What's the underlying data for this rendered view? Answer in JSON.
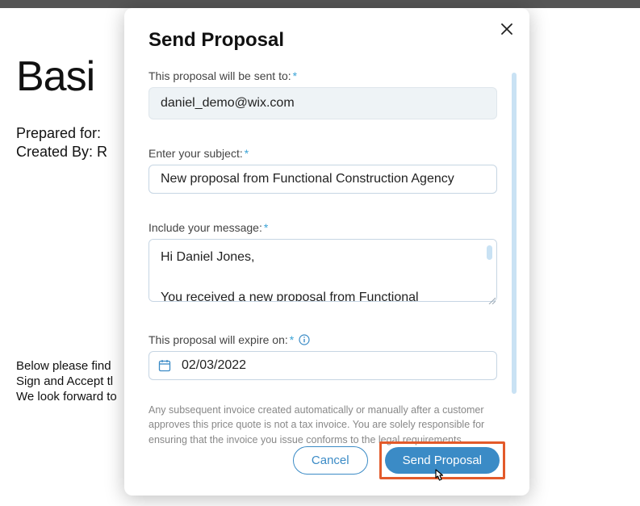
{
  "background": {
    "title": "Basi",
    "preparedFor": "Prepared for:",
    "createdBy": "Created By: R",
    "paragraph": {
      "l1": "Below please find",
      "l2": "Sign and Accept tl",
      "l3": "We look forward to"
    }
  },
  "modal": {
    "title": "Send Proposal",
    "fields": {
      "recipientLabel": "This proposal will be sent to:",
      "recipientValue": "daniel_demo@wix.com",
      "subjectLabel": "Enter your subject:",
      "subjectValue": "New proposal from Functional Construction Agency",
      "messageLabel": "Include your message:",
      "messageValue": "Hi Daniel Jones,\n\nYou received a new proposal from Functional",
      "expireLabel": "This proposal will expire on:",
      "expireValue": "02/03/2022"
    },
    "legal": "Any subsequent invoice created automatically or manually after a customer approves this price quote is not a tax invoice. You are solely responsible for ensuring that the invoice you issue conforms to the legal requirements",
    "buttons": {
      "cancel": "Cancel",
      "send": "Send Proposal"
    }
  }
}
